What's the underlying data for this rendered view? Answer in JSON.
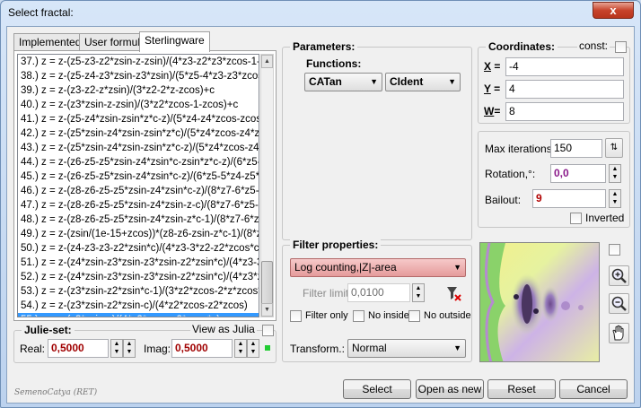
{
  "window": {
    "title": "Select fractal:",
    "close_glyph": "x"
  },
  "tabs": [
    {
      "label": "Implemented"
    },
    {
      "label": "User formula"
    },
    {
      "label": "Sterlingware"
    }
  ],
  "formulas": [
    "37.) z = z-(z5-z3-z2*zsin-z-zsin)/(4*z3-z2*z3*zcos-1-zcos",
    "38.) z = z-(z5-z4-z3*zsin-z3*zsin)/(5*z5-4*z3-z3*zcos-1-zcos",
    "39.) z = z-(z3-z2-z*zsin)/(3*z2-2*z-zcos)+c",
    "40.) z = z-(z3*zsin-z-zsin)/(3*z2*zcos-1-zcos)+c",
    "41.) z = z-(z5-z4*zsin-zsin*z*c-z)/(5*z4-z4*zcos-zcos*z*c",
    "42.) z = z-(z5*zsin-z4*zsin-zsin*z*c)/(5*z4*zcos-z4*zcos",
    "43.) z = z-(z5*zsin-z4*zsin-zsin*z*c-z)/(5*z4*zcos-z4*zcos",
    "44.) z = z-(z6-z5-z5*zsin-z4*zsin*c-zsin*z*c-z)/(6*z5-5*z4",
    "45.) z = z-(z6-z5-z5*zsin-z4*zsin*c-z)/(6*z5-5*z4-z5*zcos",
    "46.) z = z-(z8-z6-z5-z5*zsin-z4*zsin*c-z)/(8*z7-6*z5-5*z4",
    "47.) z = z-(z8-z6-z5-z5*zsin-z4*zsin-z-c)/(8*z7-6*z5-5*z4",
    "48.) z = z-(z8-z6-z5-z5*zsin-z4*zsin-z*c-1)/(8*z7-6*z5-5*z4",
    "49.) z = z-(zsin/(1e-15+zcos))*(z8-z6-zsin-z*c-1)/(8*z7-6*",
    "50.) z = z-(z4-z3-z3-z2*zsin*c)/(4*z3-3*z2-z2*zcos*c)",
    "51.) z = z-(z4*zsin-z3*zsin-z3*zsin-z2*zsin*c)/(4*z3-3*z2-z",
    "52.) z = z-(z4*zsin-z3*zsin-z3*zsin-z2*zsin*c)/(4*z3*zcos-z",
    "53.) z = z-(z3*zsin-z2*zsin*c-1)/(3*z2*zcos-2*z*zcos*c)",
    "54.) z = z-(z3*zsin-z2*zsin-c)/(4*z2*zcos-z2*zcos)",
    "55.) z = z-(z3*zsin-z)/(4*z2*zcos-z2*zcos*c)"
  ],
  "selected_index": 18,
  "julia": {
    "title": "Julie-set:",
    "view_as_julia": "View as Julia",
    "real_label": "Real:",
    "real_value": "0,5000",
    "imag_label": "Imag:",
    "imag_value": "0,5000"
  },
  "parameters": {
    "title": "Parameters:",
    "functions_label": "Functions:",
    "func1": "CATan",
    "func2": "CIdent"
  },
  "coordinates": {
    "title": "Coordinates:",
    "const_label": "const:",
    "x_label": "X",
    "x_value": "-4",
    "y_label": "Y",
    "y_value": "4",
    "w_label": "W",
    "w_value": "8"
  },
  "iteration": {
    "max_iter_label": "Max iterations:",
    "max_iter_value": "150",
    "rotation_label": "Rotation,°:",
    "rotation_value": "0,0",
    "bailout_label": "Bailout:",
    "bailout_value": "9",
    "inverted_label": "Inverted"
  },
  "filter": {
    "title": "Filter properties:",
    "mode": "Log counting,|Z|-area",
    "limit_label": "Filter limit:",
    "limit_value": "0,0100",
    "filter_only": "Filter only",
    "no_inside": "No inside",
    "no_outside": "No outside",
    "transform_label": "Transform.:",
    "transform_value": "Normal"
  },
  "footer": {
    "signature": "SemenoCatya (RET)",
    "select": "Select",
    "open_as_new": "Open as new",
    "reset": "Reset",
    "cancel": "Cancel"
  },
  "icons": [
    "zoom-in-icon",
    "zoom-out-icon",
    "hand-pan-icon",
    "filter-tool-icon",
    "spin-arrows-icon"
  ]
}
